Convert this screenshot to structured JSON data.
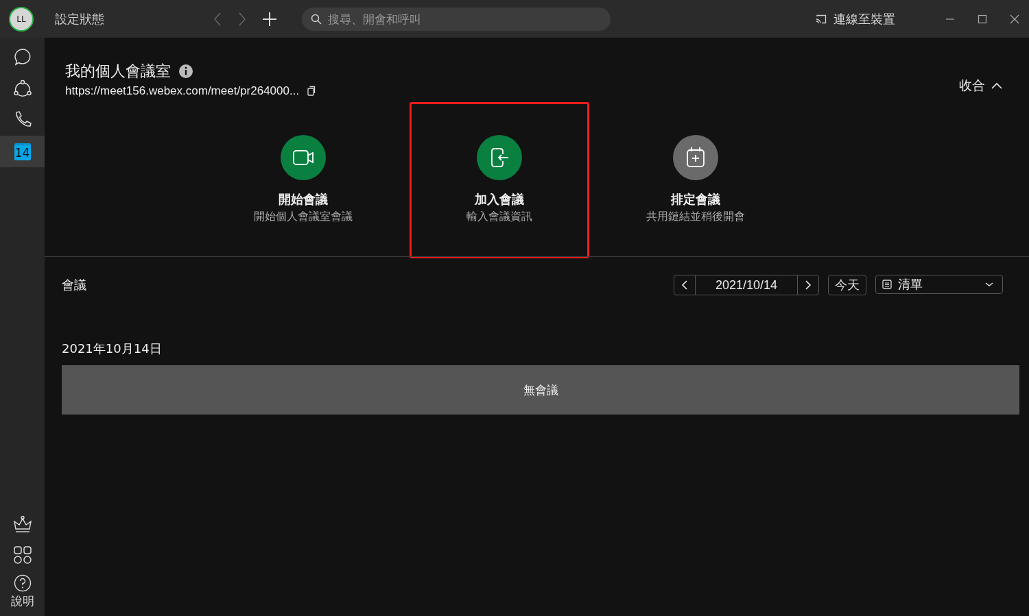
{
  "titlebar": {
    "avatar": "LL",
    "status": "設定狀態",
    "search": {
      "placeholder": "搜尋、開會和呼叫"
    },
    "connect": "連線至裝置"
  },
  "sidebar": {
    "items": [
      {
        "kind": "chat",
        "selected": false
      },
      {
        "kind": "teams",
        "selected": false
      },
      {
        "kind": "calls",
        "selected": false
      },
      {
        "kind": "calendar",
        "label": "14",
        "selected": true
      }
    ],
    "bottom": [
      {
        "kind": "crown"
      },
      {
        "kind": "apps"
      },
      {
        "kind": "help",
        "label": "說明"
      }
    ]
  },
  "room": {
    "title": "我的個人會議室",
    "url": "https://meet156.webex.com/meet/pr264000...",
    "collapse": "收合"
  },
  "actions": [
    {
      "kind": "video",
      "title": "開始會議",
      "subtitle": "開始個人會議室會議",
      "color": "#0a8040",
      "highlighted": false
    },
    {
      "kind": "join",
      "title": "加入會議",
      "subtitle": "輸入會議資訊",
      "color": "#0a8040",
      "highlighted": true
    },
    {
      "kind": "schedule",
      "title": "排定會議",
      "subtitle": "共用鏈結並稍後開會",
      "color": "#6a6a6a",
      "highlighted": false
    }
  ],
  "meetings": {
    "heading": "會議",
    "date": "2021/10/14",
    "today": "今天",
    "view": "清單",
    "day": "2021年10月14日",
    "empty": "無會議"
  }
}
